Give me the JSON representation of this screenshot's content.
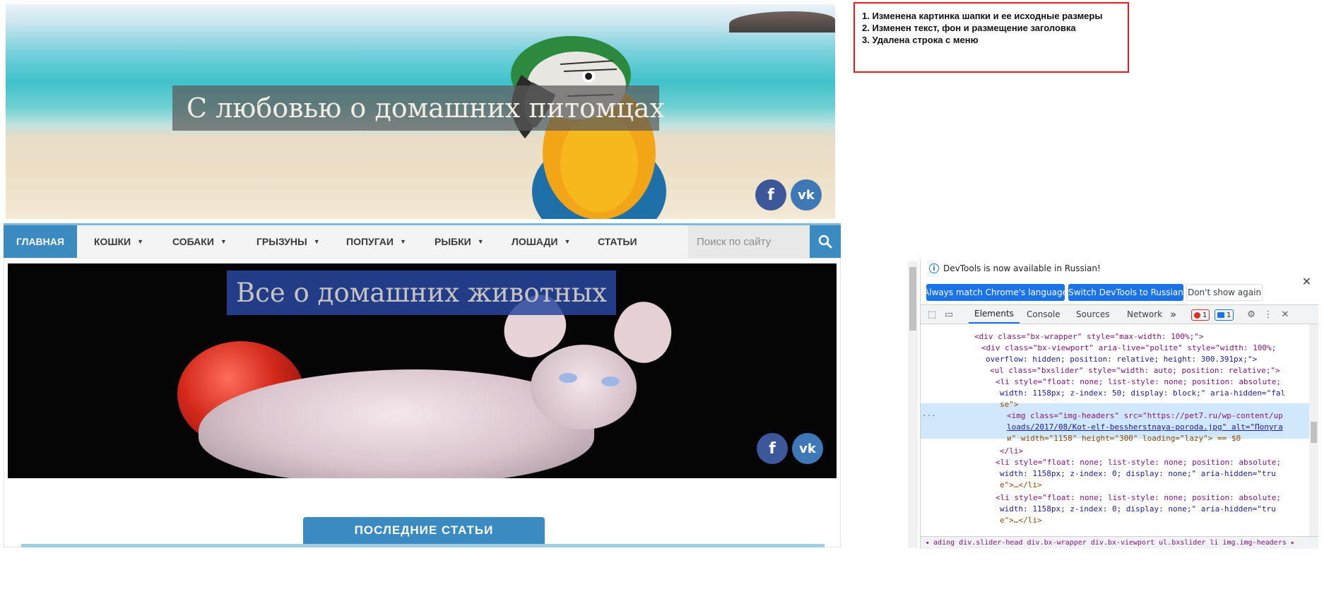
{
  "header": {
    "title": "С любовью о домашних питомцах",
    "social": {
      "facebook": "f",
      "vk": "vk"
    }
  },
  "nav": {
    "items": [
      {
        "label": "ГЛАВНАЯ",
        "active": true,
        "dropdown": false
      },
      {
        "label": "КОШКИ",
        "active": false,
        "dropdown": true
      },
      {
        "label": "СОБАКИ",
        "active": false,
        "dropdown": true
      },
      {
        "label": "ГРЫЗУНЫ",
        "active": false,
        "dropdown": true
      },
      {
        "label": "ПОПУГАИ",
        "active": false,
        "dropdown": true
      },
      {
        "label": "РЫБКИ",
        "active": false,
        "dropdown": true
      },
      {
        "label": "ЛОШАДИ",
        "active": false,
        "dropdown": true
      },
      {
        "label": "СТАТЬИ",
        "active": false,
        "dropdown": false
      }
    ],
    "search_placeholder": "Поиск по сайту",
    "caret": "▼"
  },
  "slider": {
    "title": "Все о домашних животных"
  },
  "section": {
    "title": "ПОСЛЕДНИЕ СТАТЬИ"
  },
  "notes": [
    "1. Изменена картинка шапки и ее исходные размеры",
    "2. Изменен текст, фон и размещение заголовка",
    "3. Удалена строка с меню"
  ],
  "devtools": {
    "infobar_text": "DevTools is now available in Russian!",
    "buttons": {
      "match_language": "Always match Chrome's language",
      "switch_russian": "Switch DevTools to Russian",
      "dont_show": "Don't show again"
    },
    "tabs": [
      "Elements",
      "Console",
      "Sources",
      "Network"
    ],
    "more_tabs": "»",
    "error_count": "1",
    "message_count": "1",
    "breadcrumbs": "◂  ading   div.slider-head   div.bx-wrapper   div.bx-viewport   ul.bxslider   li   img.img-headers   ▸",
    "dom_lines": [
      "<div class=\"bx-wrapper\" style=\"max-width: 100%;\">",
      "<div class=\"bx-viewport\" aria-live=\"polite\" style=\"width: 100%;",
      "overflow: hidden; position: relative; height: 300.391px;\">",
      "<ul class=\"bxslider\" style=\"width: auto; position: relative;\">",
      "<li style=\"float: none; list-style: none; position: absolute;",
      "width: 1158px; z-index: 50; display: block;\" aria-hidden=\"fal",
      "se\">",
      "<img class=\"img-headers\" src=\"https://pet7.ru/wp-content/up",
      "loads/2017/08/Kot-elf-bessherstnaya-poroda.jpg\" alt=\"Попуга",
      "и\" width=\"1158\" height=\"300\" loading=\"lazy\"> == $0",
      "</li>",
      "<li style=\"float: none; list-style: none; position: absolute;",
      "width: 1158px; z-index: 0; display: none;\" aria-hidden=\"tru",
      "e\">…</li>",
      "<li style=\"float: none; list-style: none; position: absolute;",
      "width: 1158px; z-index: 0; display: none;\" aria-hidden=\"tru",
      "e\">…</li>"
    ]
  }
}
